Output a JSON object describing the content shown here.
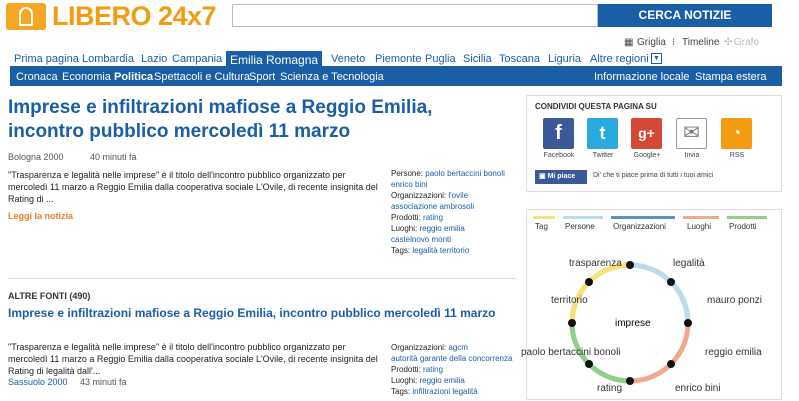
{
  "header": {
    "logo_text": "LIBERO 24x7",
    "search_button": "CERCA NOTIZIE",
    "views": [
      "Griglia",
      "Timeline",
      "Grafo"
    ]
  },
  "nav_regions": [
    "Prima pagina",
    "Lombardia",
    "Lazio",
    "Campania",
    "Emilia Romagna",
    "Veneto",
    "Piemonte",
    "Puglia",
    "Sicilia",
    "Toscana",
    "Liguria",
    "Altre regioni"
  ],
  "nav_active": "Emilia Romagna",
  "nav_sections": [
    "Cronaca",
    "Economia",
    "Politica",
    "Spettacoli e Cultura",
    "Sport",
    "Scienza e Tecnologia"
  ],
  "nav_right": [
    "Informazione locale",
    "Stampa estera"
  ],
  "article": {
    "title": "Imprese e infiltrazioni mafiose a Reggio Emilia, incontro pubblico mercoledì 11 marzo",
    "source": "Bologna 2000",
    "time": "40 minuti fa",
    "body": "\"Trasparenza e legalità nelle imprese\" è il titolo dell'incontro pubblico organizzato per mercoledì 11 marzo a Reggio Emilia dalla cooperativa sociale L'Ovile, di recente insignita del Rating di ...",
    "read_more": "Leggi la notizia",
    "tags": [
      {
        "k": "Persone:",
        "v": "paolo bertaccini bonoli"
      },
      {
        "k": "",
        "v": "enrico bini"
      },
      {
        "k": "Organizzazioni:",
        "v": "l'ovile"
      },
      {
        "k": "",
        "v": "associazione ambrosoli"
      },
      {
        "k": "Prodotti:",
        "v": "rating"
      },
      {
        "k": "Luoghi:",
        "v": "reggio emilia"
      },
      {
        "k": "",
        "v": "castelnovo monti"
      },
      {
        "k": "Tags:",
        "v": "legalità territorio"
      }
    ]
  },
  "other": {
    "heading": "ALTRE FONTI (490)",
    "title": "Imprese e infiltrazioni mafiose a Reggio Emilia, incontro pubblico mercoledì 11 marzo",
    "body": "\"Trasparenza e legalità nelle imprese\" è il titolo dell'incontro pubblico organizzato per mercoledì 11 marzo a Reggio Emilia dalla cooperativa sociale L'Ovile, di recente insignita del Rating di legalità dall'...",
    "source": "Sassuolo 2000",
    "time": "43 minuti fa",
    "tags": [
      {
        "k": "Organizzazioni:",
        "v": "agcm"
      },
      {
        "k": "",
        "v": "autorità garante della concorrenza"
      },
      {
        "k": "Prodotti:",
        "v": "rating"
      },
      {
        "k": "Luoghi:",
        "v": "reggio emilia"
      },
      {
        "k": "Tags:",
        "v": "infiltrazioni legalità"
      }
    ]
  },
  "share": {
    "title": "CONDIVIDI QUESTA PAGINA SU",
    "items": [
      "Facebook",
      "Twitter",
      "Google+",
      "Invia",
      "RSS"
    ],
    "like": "Mi piace",
    "like_text": "Di' che ti piace prima di tutti i tuoi amici"
  },
  "tag_cloud": {
    "tabs": [
      "Tag",
      "Persone",
      "Organizzazioni",
      "Luoghi",
      "Prodotti"
    ],
    "center": "imprese",
    "nodes": [
      "trasparenza",
      "legalità",
      "territorio",
      "mauro ponzi",
      "paolo bertaccini bonoli",
      "reggio emilia",
      "rating",
      "enrico bini"
    ]
  },
  "colors": {
    "brand": "#1a5ea6",
    "accent": "#f39c12"
  }
}
